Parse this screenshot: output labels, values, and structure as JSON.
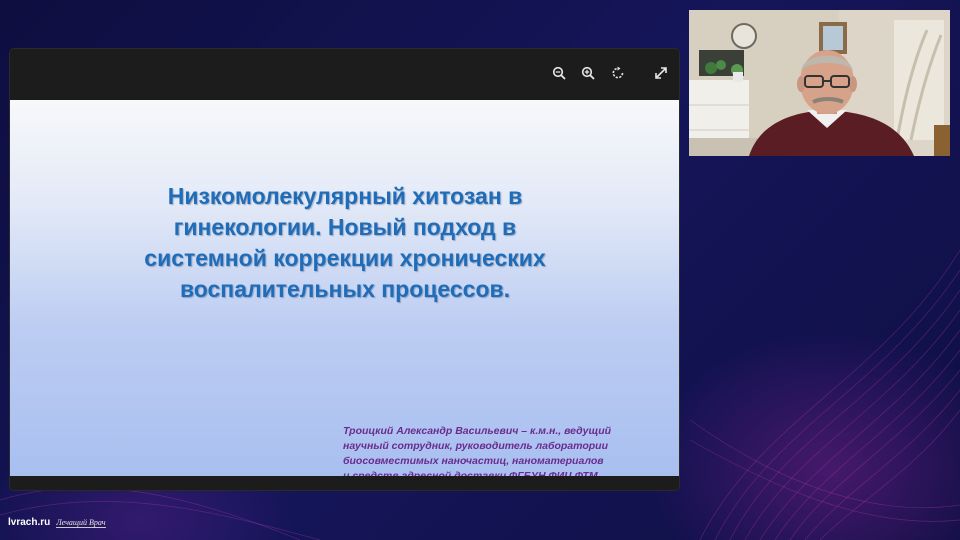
{
  "viewer": {
    "toolbar_icons": [
      "zoom-out-icon",
      "zoom-in-icon",
      "rotate-icon",
      "fullscreen-icon"
    ]
  },
  "slide": {
    "title": "Низкомолекулярный хитозан в\nгинекологии. Новый подход в\nсистемной коррекции хронических\nвоспалительных процессов.",
    "author": "Троицкий Александр Васильевич – к.м.н., ведущий\nнаучный сотрудник, руководитель лаборатории\nбиосовместимых наночастиц, наноматериалов\nи средств адресной доставки ФГБУН ФИЦ ФТМ",
    "title_color": "#1f6db8",
    "author_color": "#6a2c8e"
  },
  "branding": {
    "site": "lvrach.ru",
    "journal": "Лечащий Врач"
  },
  "colors": {
    "background": "#10104a",
    "wave": "#c03cc0"
  }
}
